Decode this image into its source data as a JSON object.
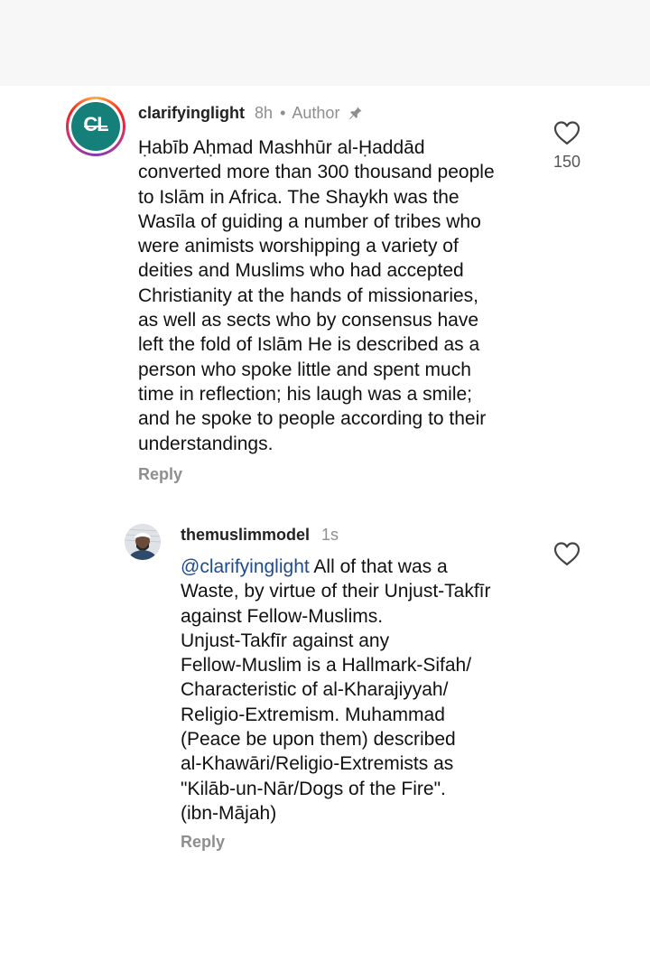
{
  "comment": {
    "username": "clarifyinglight",
    "time": "8h",
    "separator": "•",
    "author_label": "Author",
    "avatar_text": "CL",
    "text": "Ḥabīb Aḥmad Mashhūr al-Ḥaddād\nconverted more than 300 thousand people\nto Islām in Africa. The Shaykh was the\nWasīla of guiding a number of tribes who\nwere animists worshipping a variety of\ndeities and Muslims who had accepted\nChristianity at the hands of missionaries,\nas well as sects who by consensus have\nleft the fold of Islām He is described as a\nperson who spoke little and spent much\ntime in reflection; his laugh was a smile;\nand he spoke to people according to their\nunderstandings.",
    "reply_label": "Reply",
    "like_count": "150"
  },
  "reply": {
    "username": "themuslimmodel",
    "time": "1s",
    "mention": "@clarifyinglight",
    "text": " All of that was a\nWaste, by virtue of their Unjust-Takfīr\nagainst Fellow-Muslims.\nUnjust-Takfīr against any\nFellow-Muslim is a Hallmark-Sifah/\nCharacteristic of al-Kharajiyyah/\nReligio-Extremism. Muhammad\n(Peace be upon them) described\nal-Khawāri/Religio-Extremists as\n\"Kilāb-un-Nār/Dogs of the Fire\".\n(ibn-Mājah)",
    "reply_label": "Reply"
  },
  "colors": {
    "meta_gray": "#8e8e8e",
    "mention_blue": "#1d4b8e",
    "avatar_teal": "#15807a"
  },
  "icons": {
    "pin": "pin-icon",
    "heart": "heart-outline-icon"
  }
}
